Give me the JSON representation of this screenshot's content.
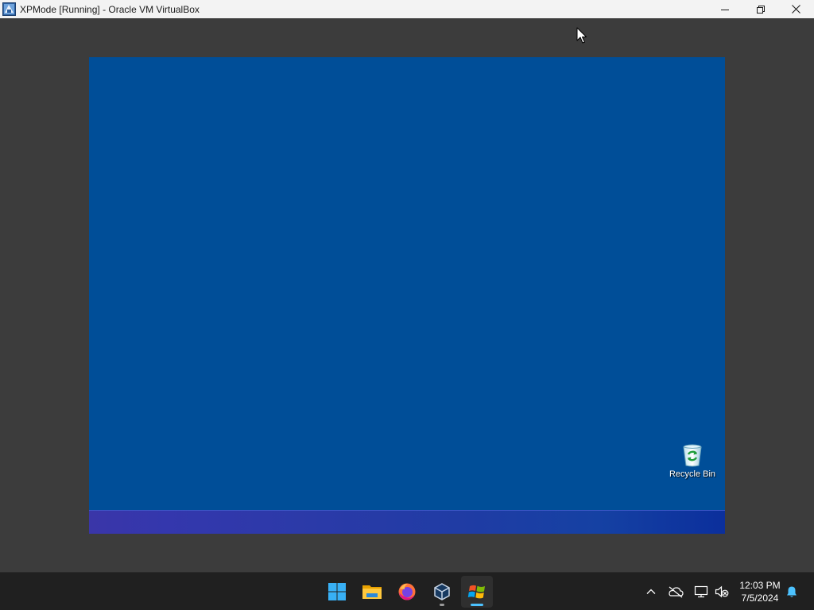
{
  "window": {
    "title": "XPMode [Running] - Oracle VM VirtualBox",
    "icon": "virtualbox-app-icon",
    "controls": [
      "minimize-icon",
      "restore-icon",
      "close-icon"
    ]
  },
  "guest": {
    "desktop_color": "#004e98",
    "desktop_icons": [
      {
        "label": "Recycle Bin",
        "icon": "recycle-bin-icon"
      }
    ]
  },
  "host_taskbar": {
    "apps": [
      {
        "name": "Start",
        "icon": "windows-start-icon",
        "active": false
      },
      {
        "name": "File Explorer",
        "icon": "file-explorer-icon",
        "active": false
      },
      {
        "name": "Firefox",
        "icon": "firefox-icon",
        "active": false
      },
      {
        "name": "Oracle VM VirtualBox",
        "icon": "virtualbox-icon",
        "active": false,
        "running": true
      },
      {
        "name": "XPMode",
        "icon": "windows-xp-icon",
        "active": true
      }
    ],
    "tray": {
      "icons": [
        "chevron-up-icon",
        "onedrive-offline-icon",
        "network-icon",
        "volume-muted-icon",
        "notification-bell-icon"
      ],
      "time": "12:03 PM",
      "date": "7/5/2024"
    }
  }
}
